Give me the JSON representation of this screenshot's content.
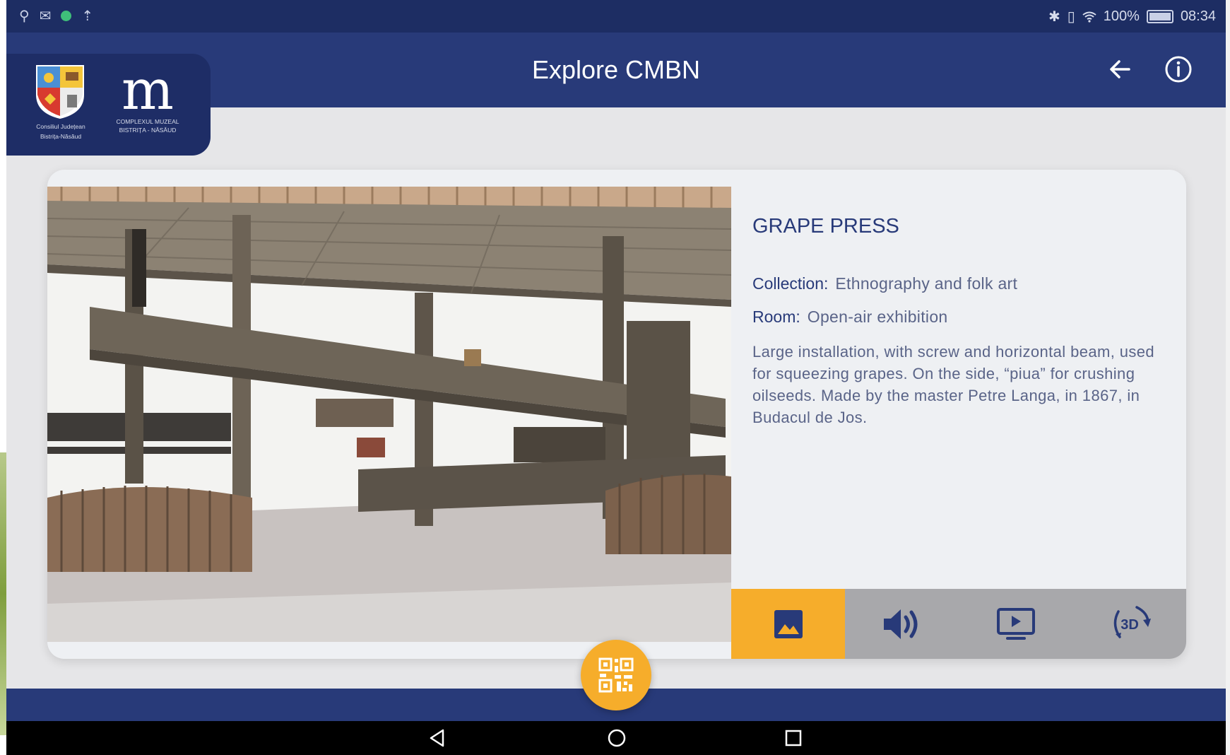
{
  "status_bar": {
    "left_icons": [
      "usb-icon",
      "gmail-icon",
      "green-dot-icon",
      "upload-icon"
    ],
    "right_icons": [
      "bluetooth-icon",
      "vibrate-icon",
      "wifi-icon",
      "battery-icon"
    ],
    "battery_percent": "100%",
    "time": "08:34"
  },
  "header": {
    "title": "Explore CMBN",
    "back_icon": "arrow-left-icon",
    "info_icon": "info-icon"
  },
  "logos": {
    "council_caption_1": "Consiliul Județean",
    "council_caption_2": "Bistrița-Năsăud",
    "museum_letter": "m",
    "museum_caption_1": "COMPLEXUL MUZEAL",
    "museum_caption_2": "BISTRIȚA - NĂSĂUD"
  },
  "item": {
    "title": "GRAPE PRESS",
    "collection_label": "Collection:",
    "collection_value": "Ethnography and folk art",
    "room_label": "Room:",
    "room_value": "Open-air exhibition",
    "description": "Large installation, with screw and horizontal beam, used for squeezing grapes. On the side, “piua” for crushing oilseeds. Made by the master Petre Langa, in 1867, in Budacul de Jos."
  },
  "media_tabs": [
    {
      "name": "image-icon",
      "active": true
    },
    {
      "name": "audio-icon",
      "active": false
    },
    {
      "name": "video-icon",
      "active": false
    },
    {
      "name": "3d-rotate-icon",
      "active": false,
      "label": "3D"
    }
  ],
  "qr_button": {
    "icon": "qr-code-icon"
  },
  "nav_bar": [
    "back-triangle-icon",
    "home-circle-icon",
    "recent-square-icon"
  ],
  "colors": {
    "primary_navy": "#283a79",
    "accent_orange": "#f6ad2b",
    "media_bar_gray": "#a8a8ab"
  }
}
